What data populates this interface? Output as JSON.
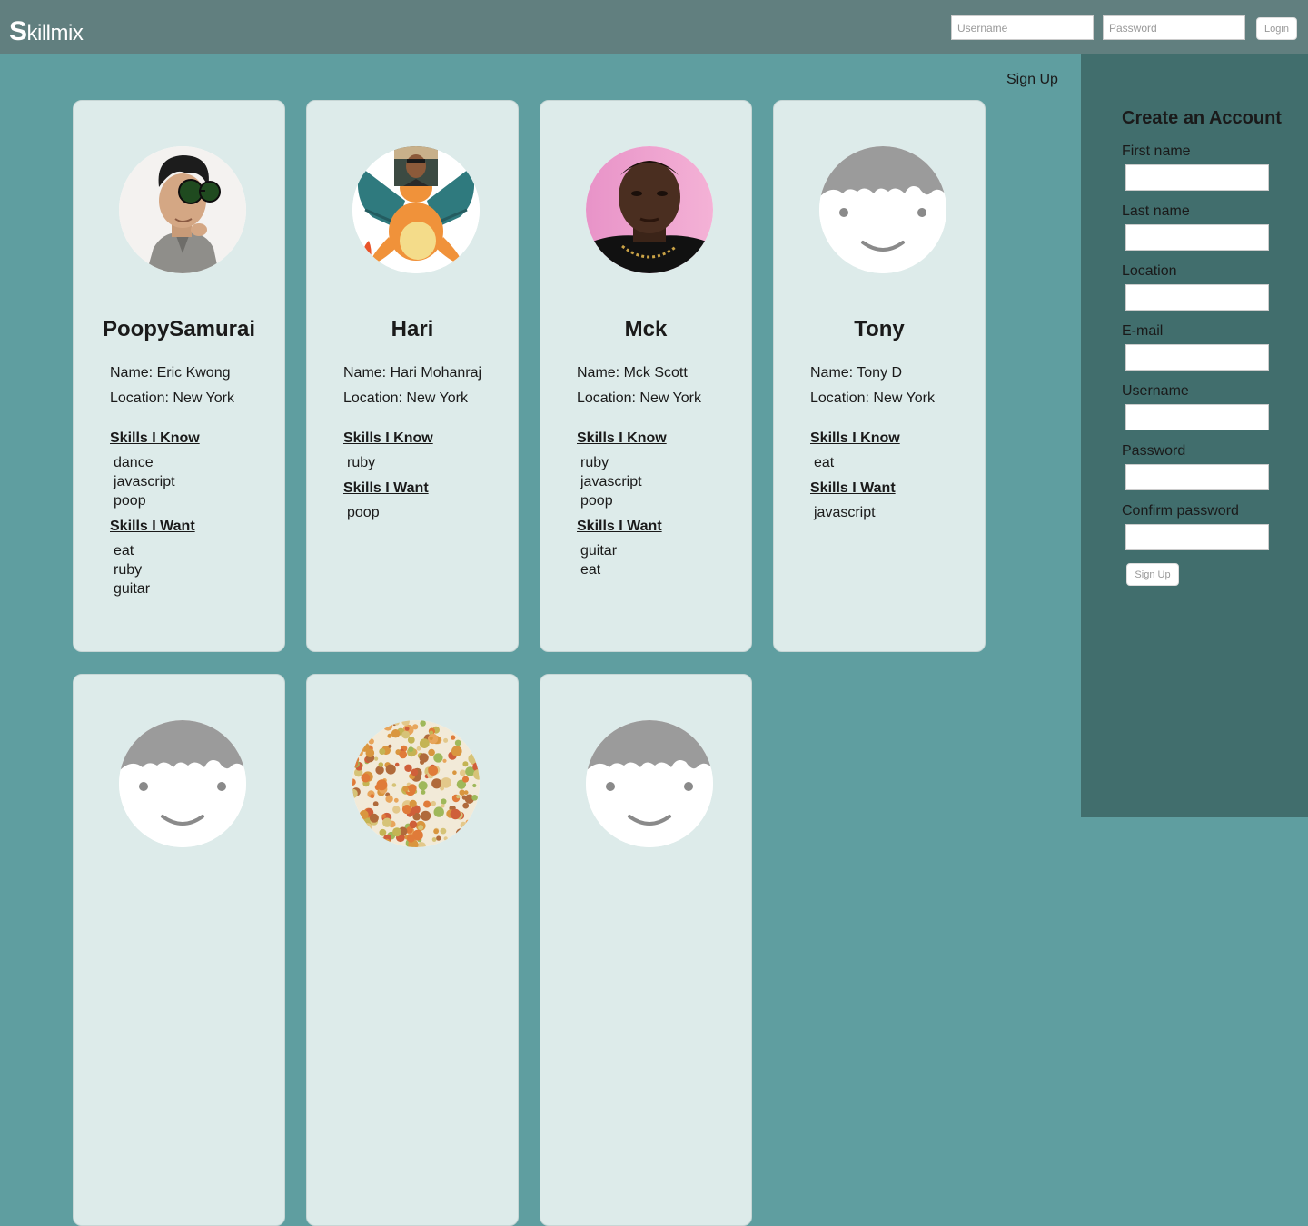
{
  "header": {
    "logo_first": "S",
    "logo_rest": "killmix",
    "username_placeholder": "Username",
    "password_placeholder": "Password",
    "login_label": "Login"
  },
  "main": {
    "signup_link": "Sign Up"
  },
  "labels": {
    "name_prefix": "Name: ",
    "location_prefix": "Location: ",
    "skills_know": "Skills I Know",
    "skills_want": "Skills I Want"
  },
  "cards": [
    {
      "username": "PoopySamurai",
      "name": "Eric Kwong",
      "location": "New York",
      "skills_know": [
        "dance",
        "javascript",
        "poop"
      ],
      "skills_want": [
        "eat",
        "ruby",
        "guitar"
      ],
      "avatar": "photo-man-sunglasses"
    },
    {
      "username": "Hari",
      "name": "Hari Mohanraj",
      "location": "New York",
      "skills_know": [
        "ruby"
      ],
      "skills_want": [
        "poop"
      ],
      "avatar": "charizard-dragon"
    },
    {
      "username": "Mck",
      "name": "Mck Scott",
      "location": "New York",
      "skills_know": [
        "ruby",
        "javascript",
        "poop"
      ],
      "skills_want": [
        "guitar",
        "eat"
      ],
      "avatar": "photo-man-portrait"
    },
    {
      "username": "Tony",
      "name": "Tony D",
      "location": "New York",
      "skills_know": [
        "eat"
      ],
      "skills_want": [
        "javascript"
      ],
      "avatar": "default-face"
    },
    {
      "avatar": "default-face"
    },
    {
      "avatar": "color-dots-circle"
    },
    {
      "avatar": "default-face"
    }
  ],
  "sidebar": {
    "title": "Create an Account",
    "fields": [
      "First name",
      "Last name",
      "Location",
      "E-mail",
      "Username",
      "Password",
      "Confirm password"
    ],
    "signup_label": "Sign Up"
  },
  "colors": {
    "background": "#5f9ea0",
    "topbar": "#617f7f",
    "card": "#ddebea",
    "sidebar": "#416e6d"
  }
}
